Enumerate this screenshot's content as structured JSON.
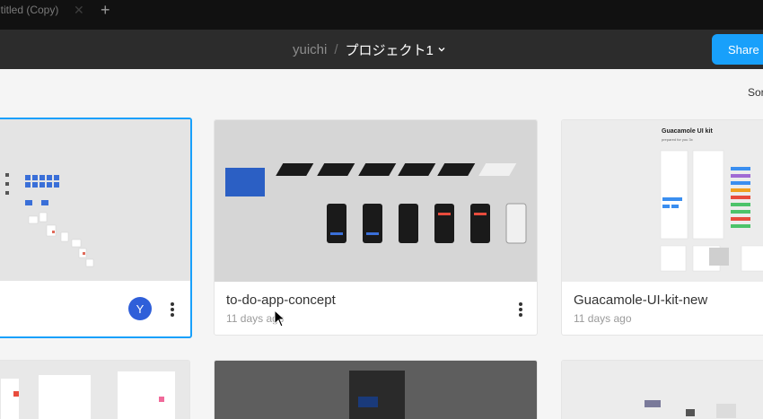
{
  "tab": {
    "title": "ititled (Copy)",
    "close_glyph": "✕",
    "add_glyph": "+"
  },
  "header": {
    "user": "yuichi",
    "separator": "/",
    "project": "プロジェクト1",
    "share_label": "Share"
  },
  "toolbar": {
    "sort_label": "Sor"
  },
  "files": [
    {
      "title": "",
      "date": "",
      "avatar_initial": "Y",
      "selected": true
    },
    {
      "title": "to-do-app-concept",
      "date": "11 days ago"
    },
    {
      "title": "Guacamole-UI-kit-new",
      "date": "11 days ago",
      "thumb_heading": "Guacamole UI kit",
      "thumb_subheading": "prepared for you 3x"
    }
  ],
  "colors": {
    "accent": "#18a0fb",
    "avatar": "#2f5fd9",
    "header_bg": "#2c2c2c",
    "tab_bg": "#111111"
  }
}
